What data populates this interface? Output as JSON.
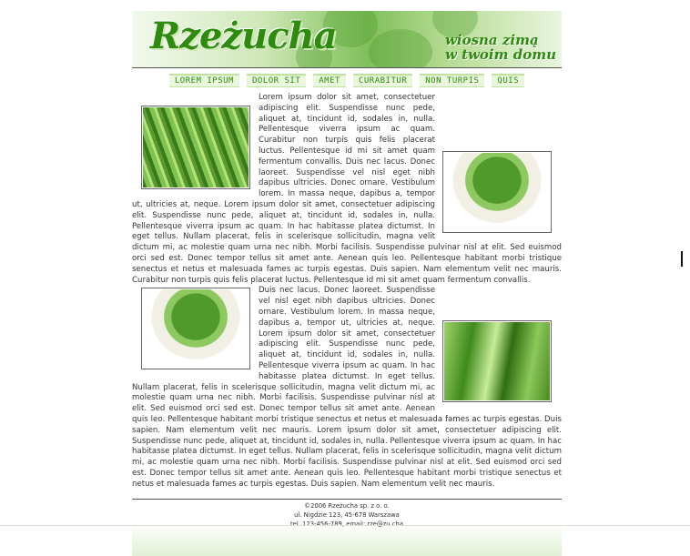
{
  "header": {
    "logo": "Rzeżucha",
    "tagline_line1": "wiosna zimą",
    "tagline_line2": "w twoim domu"
  },
  "nav": {
    "items": [
      "LOREM IPSUM",
      "DOLOR SIT",
      "AMET",
      "CURABITUR",
      "NON TURPIS",
      "QUIS"
    ]
  },
  "content": {
    "p1": "Lorem ipsum dolor sit amet, consectetuer adipiscing elit. Suspendisse nunc pede, aliquet at, tincidunt id, sodales in, nulla. Pellentesque viverra ipsum ac quam. Curabitur non turpis quis felis placerat luctus. Pellentesque id mi sit amet quam fermentum convallis. Duis nec lacus. Donec laoreet. Suspendisse vel nisl eget nibh dapibus ultricies. Donec ornare. Vestibulum lorem. In massa neque, dapibus a, tempor ut, ultricies at, neque. Lorem ipsum dolor sit amet, consectetuer adipiscing elit. Suspendisse nunc pede, aliquet at, tincidunt id, sodales in, nulla. Pellentesque viverra ipsum ac quam. In hac habitasse platea dictumst. In eget tellus. Nullam placerat, felis in scelerisque sollicitudin, magna velit dictum mi, ac molestie quam urna nec nibh. Morbi facilisis. Suspendisse pulvinar nisl at elit. Sed euismod orci sed est. Donec tempor tellus sit amet ante. Aenean quis leo. Pellentesque habitant morbi tristique senectus et netus et malesuada fames ac turpis egestas. Duis sapien. Nam elementum velit nec mauris. Curabitur non turpis quis felis placerat luctus. Pellentesque id mi sit amet quam fermentum convallis.",
    "p2": "Duis nec lacus. Donec laoreet. Suspendisse vel nisl eget nibh dapibus ultricies. Donec ornare. Vestibulum lorem. In massa neque, dapibus a, tempor ut, ultricies at, neque. Lorem ipsum dolor sit amet, consectetuer adipiscing elit. Suspendisse nunc pede, aliquet at, tincidunt id, sodales in, nulla. Pellentesque viverra ipsum ac quam. In hac habitasse platea dictumst. In eget tellus. Nullam placerat, felis in scelerisque sollicitudin, magna velit dictum mi, ac molestie quam urna nec nibh. Morbi facilisis. Suspendisse pulvinar nisl at elit. Sed euismod orci sed est. Donec tempor tellus sit amet ante. Aenean quis leo. Pellentesque habitant morbi tristique senectus et netus et malesuada fames ac turpis egestas. Duis sapien. Nam elementum velit nec mauris. Lorem ipsum dolor sit amet, consectetuer adipiscing elit. Suspendisse nunc pede, aliquet at, tincidunt id, sodales in, nulla. Pellentesque viverra ipsum ac quam. In hac habitasse platea dictumst. In eget tellus. Nullam placerat, felis in scelerisque sollicitudin, magna velit dictum mi, ac molestie quam urna nec nibh. Morbi facilisis. Suspendisse pulvinar nisl at elit. Sed euismod orci sed est. Donec tempor tellus sit amet ante. Aenean quis leo. Pellentesque habitant morbi tristique senectus et netus et malesuada fames ac turpis egestas. Duis sapien. Nam elementum velit nec mauris."
  },
  "footer": {
    "line1": "©2006 Rzeżucha sp. z o. o.",
    "line2": "ul. Nigdzie 123, 45-678 Warszawa",
    "line3": "tel. 123-456-789, email: rze@zu.cha"
  },
  "colors": {
    "brand_green": "#2e8b10",
    "nav_bg": "#e9f7dc"
  }
}
